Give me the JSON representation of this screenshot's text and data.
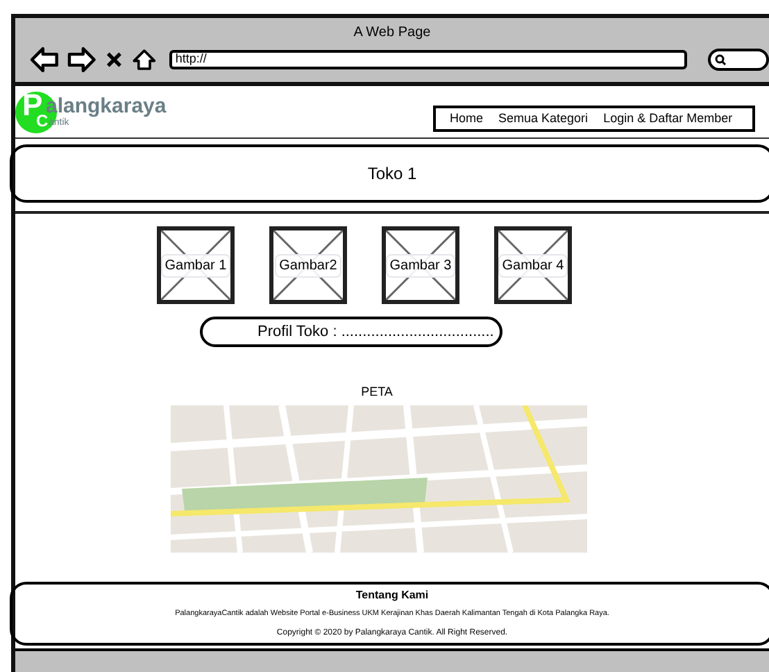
{
  "window": {
    "title": "A Web Page",
    "url": "http://"
  },
  "logo": {
    "initial_1": "P",
    "word_1": "alangkaraya",
    "initial_2": "C",
    "word_2": "antik"
  },
  "nav": [
    "Home",
    "Semua Kategori",
    "Login & Daftar Member"
  ],
  "banner": {
    "title": "Toko 1"
  },
  "images": [
    "Gambar 1",
    "Gambar2",
    "Gambar 3",
    "Gambar 4"
  ],
  "profile": {
    "label": "Profil Toko : ...................................."
  },
  "map": {
    "title": "PETA",
    "kind": "picture"
  },
  "footer": {
    "title": "Tentang Kami",
    "description": "PalangkarayaCantik adalah Website Portal e-Business UKM Kerajinan Khas Daerah Kalimantan Tengah di Kota Palangka Raya.",
    "copyright": "Copyright © 2020 by Palangkaraya Cantik. All Right Reserved."
  }
}
